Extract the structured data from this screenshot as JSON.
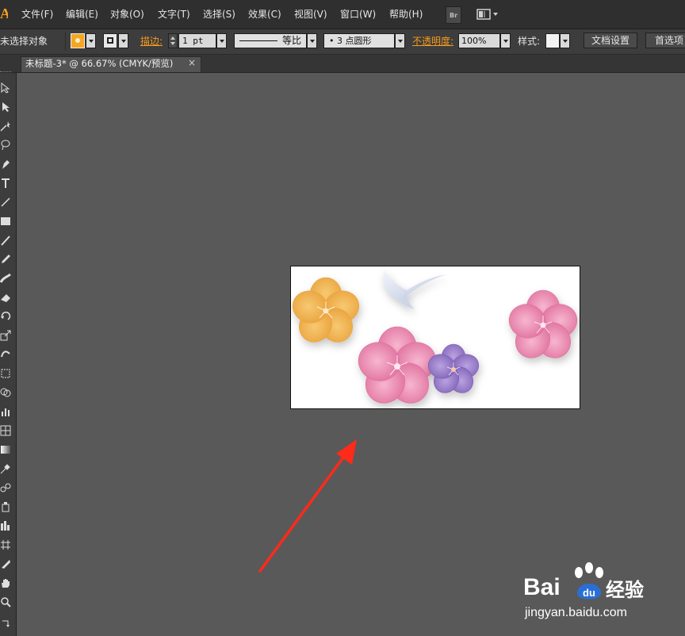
{
  "app": {
    "logo": "Ai"
  },
  "menu": [
    {
      "label": "文件(F)"
    },
    {
      "label": "编辑(E)"
    },
    {
      "label": "对象(O)"
    },
    {
      "label": "文字(T)"
    },
    {
      "label": "选择(S)"
    },
    {
      "label": "效果(C)"
    },
    {
      "label": "视图(V)"
    },
    {
      "label": "窗口(W)"
    },
    {
      "label": "帮助(H)"
    }
  ],
  "menu_buttons": {
    "bridge_label": "Br"
  },
  "control": {
    "selection_status": "未选择对象",
    "stroke_label": "描边:",
    "stroke_weight": "1 pt",
    "stroke_profile": "等比",
    "brush": "• 3 点圆形",
    "opacity_label": "不透明度:",
    "opacity_value": "100%",
    "style_label": "样式:",
    "doc_settings": "文档设置",
    "preferences": "首选项"
  },
  "document": {
    "tab_title": "未标题-3* @ 66.67% (CMYK/预览)",
    "close_glyph": "×"
  },
  "colors": {
    "accent_orange": "#f79a1c",
    "fill_swatch": "#f5a623",
    "annotation_arrow": "#ff2a1a",
    "watermark_blue": "#2a6fd6"
  },
  "watermark": {
    "brand_top": "Bai",
    "brand_bottom": "经验",
    "url": "jingyan.baidu.com"
  }
}
